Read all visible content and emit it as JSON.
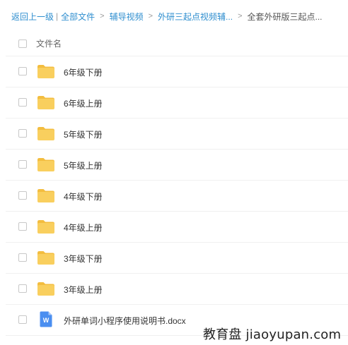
{
  "breadcrumb": {
    "back": "返回上一级",
    "pipe": "|",
    "separator": ">",
    "items": [
      "全部文件",
      "辅导视频",
      "外研三起点视频辅...",
      "全套外研版三起点..."
    ]
  },
  "list_header": {
    "name_label": "文件名"
  },
  "files": [
    {
      "name": "6年级下册",
      "type": "folder",
      "icon": "folder-icon"
    },
    {
      "name": "6年级上册",
      "type": "folder",
      "icon": "folder-icon"
    },
    {
      "name": "5年级下册",
      "type": "folder",
      "icon": "folder-icon"
    },
    {
      "name": "5年级上册",
      "type": "folder",
      "icon": "folder-icon"
    },
    {
      "name": "4年级下册",
      "type": "folder",
      "icon": "folder-icon"
    },
    {
      "name": "4年级上册",
      "type": "folder",
      "icon": "folder-icon"
    },
    {
      "name": "3年级下册",
      "type": "folder",
      "icon": "folder-icon"
    },
    {
      "name": "3年级上册",
      "type": "folder",
      "icon": "folder-icon"
    },
    {
      "name": "外研单词小程序使用说明书.docx",
      "type": "docx",
      "icon": "word-document-icon",
      "icon_letter": "W"
    }
  ],
  "watermark": {
    "text": "教育盘 jiaoyupan.com"
  },
  "colors": {
    "link": "#2e8ecf",
    "folder": "#f9cf5e",
    "folder_tab": "#f3bd3f",
    "word": "#4a8ef0"
  }
}
